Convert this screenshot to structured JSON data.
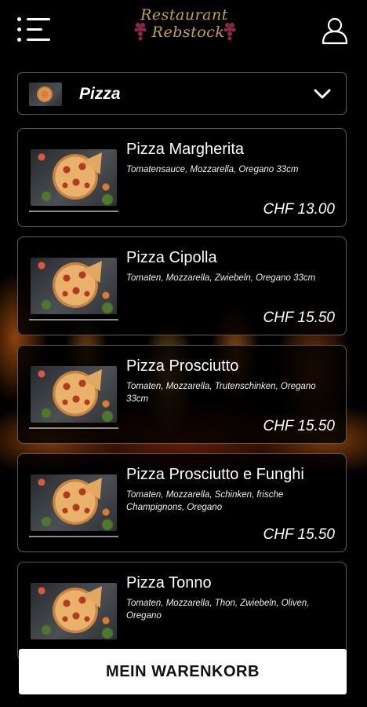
{
  "header": {
    "logo_line1": "Restaurant",
    "logo_line2": "Rebstock",
    "logo_color": "#c7a23d",
    "menu_icon": "menu-icon",
    "user_icon": "user-icon"
  },
  "category": {
    "label": "Pizza",
    "icon": "chevron-down-icon"
  },
  "products": [
    {
      "name": "Pizza Margherita",
      "desc": "Tomatensauce, Mozzarella, Oregano 33cm",
      "price": "CHF 13.00"
    },
    {
      "name": "Pizza Cipolla",
      "desc": "Tomaten, Mozzarella, Zwiebeln, Oregano 33cm",
      "price": "CHF 15.50"
    },
    {
      "name": "Pizza Prosciutto",
      "desc": "Tomaten, Mozzarella, Trutenschinken, Oregano 33cm",
      "price": "CHF 15.50"
    },
    {
      "name": "Pizza Prosciutto e Funghi",
      "desc": "Tomaten, Mozzarella, Schinken, frische Champignons, Oregano",
      "price": "CHF 15.50"
    },
    {
      "name": "Pizza Tonno",
      "desc": "Tomaten, Mozzarella, Thon, Zwiebeln, Oliven, Oregano",
      "price": ""
    }
  ],
  "cart": {
    "label": "MEIN WARENKORB"
  }
}
